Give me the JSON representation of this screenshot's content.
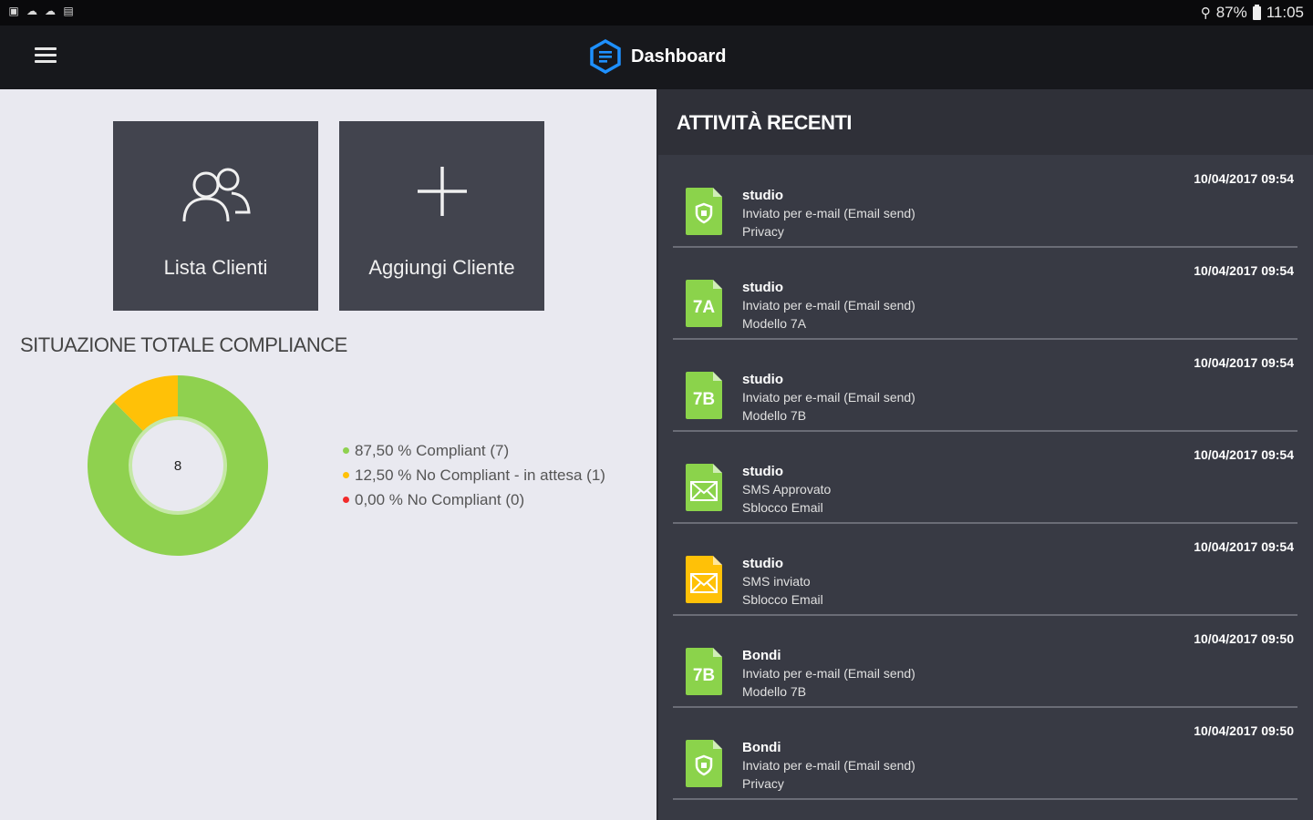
{
  "statusbar": {
    "battery": "87%",
    "time": "11:05"
  },
  "appbar": {
    "title": "Dashboard"
  },
  "tiles": [
    {
      "label": "Lista Clienti",
      "icon": "users-icon"
    },
    {
      "label": "Aggiungi Cliente",
      "icon": "plus-icon"
    }
  ],
  "compliance": {
    "title": "SITUAZIONE TOTALE COMPLIANCE",
    "center_value": "8",
    "legend": [
      {
        "text": "87,50 % Compliant (7)",
        "color": "#8fd14f"
      },
      {
        "text": "12,50 % No Compliant - in attesa (1)",
        "color": "#ffc107"
      },
      {
        "text": "0,00 % No Compliant (0)",
        "color": "#f22b2b"
      }
    ]
  },
  "chart_data": {
    "type": "pie",
    "categories": [
      "Compliant",
      "No Compliant - in attesa",
      "No Compliant"
    ],
    "values": [
      7,
      1,
      0
    ],
    "colors": [
      "#8fd14f",
      "#ffc107",
      "#f22b2b"
    ],
    "center_label": "8"
  },
  "recent": {
    "title": "ATTIVITÀ RECENTI",
    "items": [
      {
        "name": "studio",
        "action": "Inviato per e-mail (Email send)",
        "doc": "Privacy",
        "date": "10/04/2017 09:54",
        "icon": "shield",
        "icon_text": "",
        "color": "#8bd34b"
      },
      {
        "name": "studio",
        "action": "Inviato per e-mail (Email send)",
        "doc": "Modello 7A",
        "date": "10/04/2017 09:54",
        "icon": "text",
        "icon_text": "7A",
        "color": "#8bd34b"
      },
      {
        "name": "studio",
        "action": "Inviato per e-mail (Email send)",
        "doc": "Modello 7B",
        "date": "10/04/2017 09:54",
        "icon": "text",
        "icon_text": "7B",
        "color": "#8bd34b"
      },
      {
        "name": "studio",
        "action": "SMS Approvato",
        "doc": "Sblocco Email",
        "date": "10/04/2017 09:54",
        "icon": "mail",
        "icon_text": "",
        "color": "#8bd34b"
      },
      {
        "name": "studio",
        "action": "SMS inviato",
        "doc": "Sblocco Email",
        "date": "10/04/2017 09:54",
        "icon": "mail",
        "icon_text": "",
        "color": "#ffc107"
      },
      {
        "name": "Bondi",
        "action": "Inviato per e-mail (Email send)",
        "doc": "Modello 7B",
        "date": "10/04/2017 09:50",
        "icon": "text",
        "icon_text": "7B",
        "color": "#8bd34b"
      },
      {
        "name": "Bondi",
        "action": "Inviato per e-mail (Email send)",
        "doc": "Privacy",
        "date": "10/04/2017 09:50",
        "icon": "shield",
        "icon_text": "",
        "color": "#8bd34b"
      }
    ]
  }
}
